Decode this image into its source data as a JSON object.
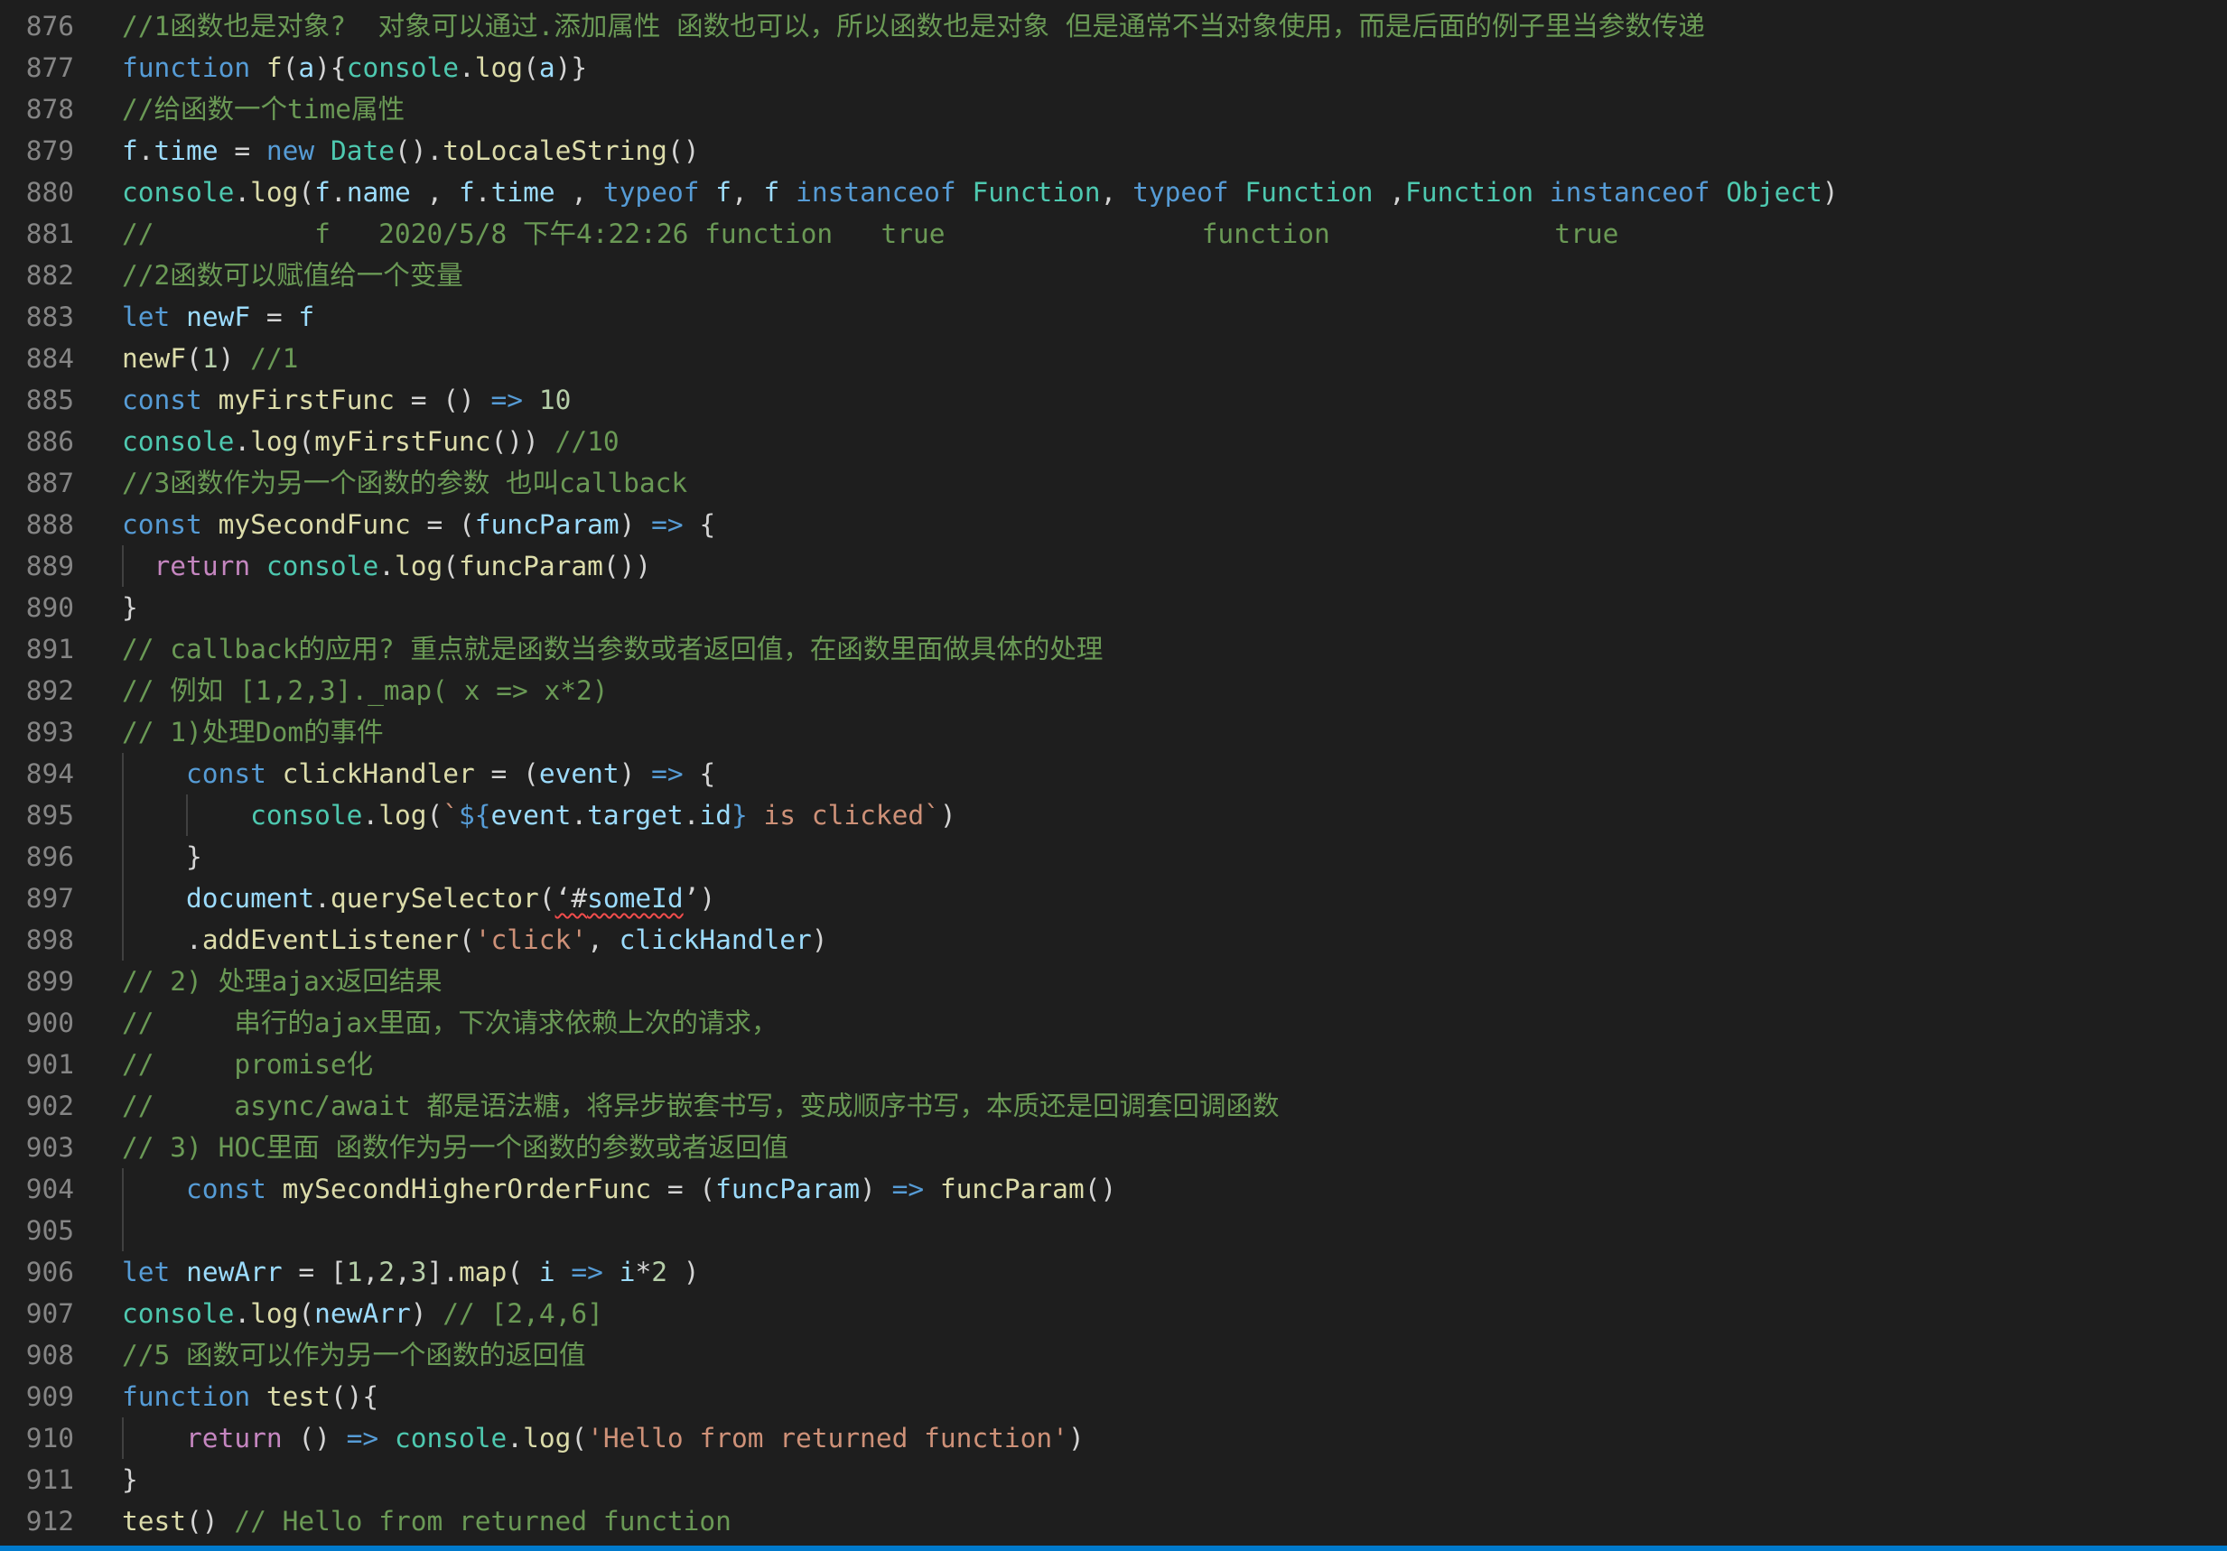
{
  "colors": {
    "background": "#1e1e1e",
    "default": "#d4d4d4",
    "comment": "#6a9955",
    "keyword": "#569cd6",
    "control": "#c586c0",
    "function": "#dcdcaa",
    "variable": "#9cdcfe",
    "type": "#4ec9b0",
    "string": "#ce9178",
    "number": "#b5cea8",
    "line_number": "#858585",
    "indent_guide": "#404040",
    "error_squiggle": "#f14c4c",
    "status_bar": "#007acc"
  },
  "editor": {
    "lines": [
      {
        "n": "876",
        "tokens": [
          {
            "t": "//1函数也是对象?  对象可以通过.添加属性 函数也可以，所以函数也是对象 但是通常不当对象使用，而是后面的例子里当参数传递",
            "c": "comment"
          }
        ]
      },
      {
        "n": "877",
        "tokens": [
          {
            "t": "function",
            "c": "keyword"
          },
          {
            "t": " ",
            "c": "default"
          },
          {
            "t": "f",
            "c": "function"
          },
          {
            "t": "(",
            "c": "default"
          },
          {
            "t": "a",
            "c": "variable"
          },
          {
            "t": "){",
            "c": "default"
          },
          {
            "t": "console",
            "c": "type"
          },
          {
            "t": ".",
            "c": "default"
          },
          {
            "t": "log",
            "c": "function"
          },
          {
            "t": "(",
            "c": "default"
          },
          {
            "t": "a",
            "c": "variable"
          },
          {
            "t": ")}",
            "c": "default"
          }
        ]
      },
      {
        "n": "878",
        "tokens": [
          {
            "t": "//给函数一个time属性",
            "c": "comment"
          }
        ]
      },
      {
        "n": "879",
        "tokens": [
          {
            "t": "f",
            "c": "variable"
          },
          {
            "t": ".",
            "c": "default"
          },
          {
            "t": "time",
            "c": "variable"
          },
          {
            "t": " = ",
            "c": "default"
          },
          {
            "t": "new",
            "c": "keyword"
          },
          {
            "t": " ",
            "c": "default"
          },
          {
            "t": "Date",
            "c": "type"
          },
          {
            "t": "().",
            "c": "default"
          },
          {
            "t": "toLocaleString",
            "c": "function"
          },
          {
            "t": "()",
            "c": "default"
          }
        ]
      },
      {
        "n": "880",
        "tokens": [
          {
            "t": "console",
            "c": "type"
          },
          {
            "t": ".",
            "c": "default"
          },
          {
            "t": "log",
            "c": "function"
          },
          {
            "t": "(",
            "c": "default"
          },
          {
            "t": "f",
            "c": "variable"
          },
          {
            "t": ".",
            "c": "default"
          },
          {
            "t": "name",
            "c": "variable"
          },
          {
            "t": " , ",
            "c": "default"
          },
          {
            "t": "f",
            "c": "variable"
          },
          {
            "t": ".",
            "c": "default"
          },
          {
            "t": "time",
            "c": "variable"
          },
          {
            "t": " , ",
            "c": "default"
          },
          {
            "t": "typeof",
            "c": "keyword"
          },
          {
            "t": " ",
            "c": "default"
          },
          {
            "t": "f",
            "c": "variable"
          },
          {
            "t": ", ",
            "c": "default"
          },
          {
            "t": "f",
            "c": "variable"
          },
          {
            "t": " ",
            "c": "default"
          },
          {
            "t": "instanceof",
            "c": "keyword"
          },
          {
            "t": " ",
            "c": "default"
          },
          {
            "t": "Function",
            "c": "type"
          },
          {
            "t": ", ",
            "c": "default"
          },
          {
            "t": "typeof",
            "c": "keyword"
          },
          {
            "t": " ",
            "c": "default"
          },
          {
            "t": "Function",
            "c": "type"
          },
          {
            "t": " ,",
            "c": "default"
          },
          {
            "t": "Function",
            "c": "type"
          },
          {
            "t": " ",
            "c": "default"
          },
          {
            "t": "instanceof",
            "c": "keyword"
          },
          {
            "t": " ",
            "c": "default"
          },
          {
            "t": "Object",
            "c": "type"
          },
          {
            "t": ")",
            "c": "default"
          }
        ]
      },
      {
        "n": "881",
        "tokens": [
          {
            "t": "//          f   2020/5/8 下午4:22:26 function   true                function              true",
            "c": "comment"
          }
        ]
      },
      {
        "n": "882",
        "tokens": [
          {
            "t": "//2函数可以赋值给一个变量",
            "c": "comment"
          }
        ]
      },
      {
        "n": "883",
        "tokens": [
          {
            "t": "let",
            "c": "keyword"
          },
          {
            "t": " ",
            "c": "default"
          },
          {
            "t": "newF",
            "c": "variable"
          },
          {
            "t": " = ",
            "c": "default"
          },
          {
            "t": "f",
            "c": "variable"
          }
        ]
      },
      {
        "n": "884",
        "tokens": [
          {
            "t": "newF",
            "c": "function"
          },
          {
            "t": "(",
            "c": "default"
          },
          {
            "t": "1",
            "c": "number"
          },
          {
            "t": ") ",
            "c": "default"
          },
          {
            "t": "//1",
            "c": "comment"
          }
        ]
      },
      {
        "n": "885",
        "tokens": [
          {
            "t": "const",
            "c": "keyword"
          },
          {
            "t": " ",
            "c": "default"
          },
          {
            "t": "myFirstFunc",
            "c": "function"
          },
          {
            "t": " = () ",
            "c": "default"
          },
          {
            "t": "=>",
            "c": "keyword"
          },
          {
            "t": " ",
            "c": "default"
          },
          {
            "t": "10",
            "c": "number"
          }
        ]
      },
      {
        "n": "886",
        "tokens": [
          {
            "t": "console",
            "c": "type"
          },
          {
            "t": ".",
            "c": "default"
          },
          {
            "t": "log",
            "c": "function"
          },
          {
            "t": "(",
            "c": "default"
          },
          {
            "t": "myFirstFunc",
            "c": "function"
          },
          {
            "t": "()) ",
            "c": "default"
          },
          {
            "t": "//10",
            "c": "comment"
          }
        ]
      },
      {
        "n": "887",
        "tokens": [
          {
            "t": "//3函数作为另一个函数的参数 也叫callback",
            "c": "comment"
          }
        ]
      },
      {
        "n": "888",
        "tokens": [
          {
            "t": "const",
            "c": "keyword"
          },
          {
            "t": " ",
            "c": "default"
          },
          {
            "t": "mySecondFunc",
            "c": "function"
          },
          {
            "t": " = (",
            "c": "default"
          },
          {
            "t": "funcParam",
            "c": "variable"
          },
          {
            "t": ") ",
            "c": "default"
          },
          {
            "t": "=>",
            "c": "keyword"
          },
          {
            "t": " {",
            "c": "default"
          }
        ]
      },
      {
        "n": "889",
        "tokens": [
          {
            "t": "  ",
            "c": "default"
          },
          {
            "t": "return",
            "c": "control"
          },
          {
            "t": " ",
            "c": "default"
          },
          {
            "t": "console",
            "c": "type"
          },
          {
            "t": ".",
            "c": "default"
          },
          {
            "t": "log",
            "c": "function"
          },
          {
            "t": "(",
            "c": "default"
          },
          {
            "t": "funcParam",
            "c": "function"
          },
          {
            "t": "())",
            "c": "default"
          }
        ]
      },
      {
        "n": "890",
        "tokens": [
          {
            "t": "}",
            "c": "default"
          }
        ]
      },
      {
        "n": "891",
        "tokens": [
          {
            "t": "// callback的应用? 重点就是函数当参数或者返回值，在函数里面做具体的处理",
            "c": "comment"
          }
        ]
      },
      {
        "n": "892",
        "tokens": [
          {
            "t": "// 例如 [1,2,3]._map( x => x*2)",
            "c": "comment"
          }
        ]
      },
      {
        "n": "893",
        "tokens": [
          {
            "t": "// 1)处理Dom的事件",
            "c": "comment"
          }
        ]
      },
      {
        "n": "894",
        "tokens": [
          {
            "t": "    ",
            "c": "default"
          },
          {
            "t": "const",
            "c": "keyword"
          },
          {
            "t": " ",
            "c": "default"
          },
          {
            "t": "clickHandler",
            "c": "function"
          },
          {
            "t": " = (",
            "c": "default"
          },
          {
            "t": "event",
            "c": "variable"
          },
          {
            "t": ") ",
            "c": "default"
          },
          {
            "t": "=>",
            "c": "keyword"
          },
          {
            "t": " {",
            "c": "default"
          }
        ]
      },
      {
        "n": "895",
        "tokens": [
          {
            "t": "        ",
            "c": "default"
          },
          {
            "t": "console",
            "c": "type"
          },
          {
            "t": ".",
            "c": "default"
          },
          {
            "t": "log",
            "c": "function"
          },
          {
            "t": "(",
            "c": "default"
          },
          {
            "t": "`",
            "c": "string"
          },
          {
            "t": "${",
            "c": "keyword"
          },
          {
            "t": "event",
            "c": "variable"
          },
          {
            "t": ".",
            "c": "default"
          },
          {
            "t": "target",
            "c": "variable"
          },
          {
            "t": ".",
            "c": "default"
          },
          {
            "t": "id",
            "c": "variable"
          },
          {
            "t": "}",
            "c": "keyword"
          },
          {
            "t": " is clicked`",
            "c": "string"
          },
          {
            "t": ")",
            "c": "default"
          }
        ]
      },
      {
        "n": "896",
        "tokens": [
          {
            "t": "    }",
            "c": "default"
          }
        ]
      },
      {
        "n": "897",
        "tokens": [
          {
            "t": "    ",
            "c": "default"
          },
          {
            "t": "document",
            "c": "variable"
          },
          {
            "t": ".",
            "c": "default"
          },
          {
            "t": "querySelector",
            "c": "function"
          },
          {
            "t": "(",
            "c": "default"
          },
          {
            "t": "‘#",
            "c": "default",
            "e": 1
          },
          {
            "t": "someId",
            "c": "variable",
            "e": 1
          },
          {
            "t": "’",
            "c": "default"
          },
          {
            "t": ")",
            "c": "default"
          }
        ]
      },
      {
        "n": "898",
        "tokens": [
          {
            "t": "    .",
            "c": "default"
          },
          {
            "t": "addEventListener",
            "c": "function"
          },
          {
            "t": "(",
            "c": "default"
          },
          {
            "t": "'click'",
            "c": "string"
          },
          {
            "t": ", ",
            "c": "default"
          },
          {
            "t": "clickHandler",
            "c": "variable"
          },
          {
            "t": ")",
            "c": "default"
          }
        ]
      },
      {
        "n": "899",
        "tokens": [
          {
            "t": "// 2) 处理ajax返回结果",
            "c": "comment"
          }
        ]
      },
      {
        "n": "900",
        "tokens": [
          {
            "t": "//     串行的ajax里面，下次请求依赖上次的请求，",
            "c": "comment"
          }
        ]
      },
      {
        "n": "901",
        "tokens": [
          {
            "t": "//     promise化",
            "c": "comment"
          }
        ]
      },
      {
        "n": "902",
        "tokens": [
          {
            "t": "//     async/await 都是语法糖，将异步嵌套书写，变成顺序书写，本质还是回调套回调函数",
            "c": "comment"
          }
        ]
      },
      {
        "n": "903",
        "tokens": [
          {
            "t": "// 3) HOC里面 函数作为另一个函数的参数或者返回值",
            "c": "comment"
          }
        ]
      },
      {
        "n": "904",
        "tokens": [
          {
            "t": "    ",
            "c": "default"
          },
          {
            "t": "const",
            "c": "keyword"
          },
          {
            "t": " ",
            "c": "default"
          },
          {
            "t": "mySecondHigherOrderFunc",
            "c": "function"
          },
          {
            "t": " = (",
            "c": "default"
          },
          {
            "t": "funcParam",
            "c": "variable"
          },
          {
            "t": ") ",
            "c": "default"
          },
          {
            "t": "=>",
            "c": "keyword"
          },
          {
            "t": " ",
            "c": "default"
          },
          {
            "t": "funcParam",
            "c": "function"
          },
          {
            "t": "()",
            "c": "default"
          }
        ]
      },
      {
        "n": "905",
        "tokens": []
      },
      {
        "n": "906",
        "tokens": [
          {
            "t": "let",
            "c": "keyword"
          },
          {
            "t": " ",
            "c": "default"
          },
          {
            "t": "newArr",
            "c": "variable"
          },
          {
            "t": " = [",
            "c": "default"
          },
          {
            "t": "1",
            "c": "number"
          },
          {
            "t": ",",
            "c": "default"
          },
          {
            "t": "2",
            "c": "number"
          },
          {
            "t": ",",
            "c": "default"
          },
          {
            "t": "3",
            "c": "number"
          },
          {
            "t": "].",
            "c": "default"
          },
          {
            "t": "map",
            "c": "function"
          },
          {
            "t": "( ",
            "c": "default"
          },
          {
            "t": "i",
            "c": "variable"
          },
          {
            "t": " ",
            "c": "default"
          },
          {
            "t": "=>",
            "c": "keyword"
          },
          {
            "t": " ",
            "c": "default"
          },
          {
            "t": "i",
            "c": "variable"
          },
          {
            "t": "*",
            "c": "default"
          },
          {
            "t": "2",
            "c": "number"
          },
          {
            "t": " )",
            "c": "default"
          }
        ]
      },
      {
        "n": "907",
        "tokens": [
          {
            "t": "console",
            "c": "type"
          },
          {
            "t": ".",
            "c": "default"
          },
          {
            "t": "log",
            "c": "function"
          },
          {
            "t": "(",
            "c": "default"
          },
          {
            "t": "newArr",
            "c": "variable"
          },
          {
            "t": ") ",
            "c": "default"
          },
          {
            "t": "// [2,4,6]",
            "c": "comment"
          }
        ]
      },
      {
        "n": "908",
        "tokens": [
          {
            "t": "//5 函数可以作为另一个函数的返回值",
            "c": "comment"
          }
        ]
      },
      {
        "n": "909",
        "tokens": [
          {
            "t": "function",
            "c": "keyword"
          },
          {
            "t": " ",
            "c": "default"
          },
          {
            "t": "test",
            "c": "function"
          },
          {
            "t": "(){",
            "c": "default"
          }
        ]
      },
      {
        "n": "910",
        "tokens": [
          {
            "t": "    ",
            "c": "default"
          },
          {
            "t": "return",
            "c": "control"
          },
          {
            "t": " () ",
            "c": "default"
          },
          {
            "t": "=>",
            "c": "keyword"
          },
          {
            "t": " ",
            "c": "default"
          },
          {
            "t": "console",
            "c": "type"
          },
          {
            "t": ".",
            "c": "default"
          },
          {
            "t": "log",
            "c": "function"
          },
          {
            "t": "(",
            "c": "default"
          },
          {
            "t": "'Hello from returned function'",
            "c": "string"
          },
          {
            "t": ")",
            "c": "default"
          }
        ]
      },
      {
        "n": "911",
        "tokens": [
          {
            "t": "}",
            "c": "default"
          }
        ]
      },
      {
        "n": "912",
        "tokens": [
          {
            "t": "test",
            "c": "function"
          },
          {
            "t": "() ",
            "c": "default"
          },
          {
            "t": "// Hello from returned function",
            "c": "comment"
          }
        ]
      }
    ]
  }
}
